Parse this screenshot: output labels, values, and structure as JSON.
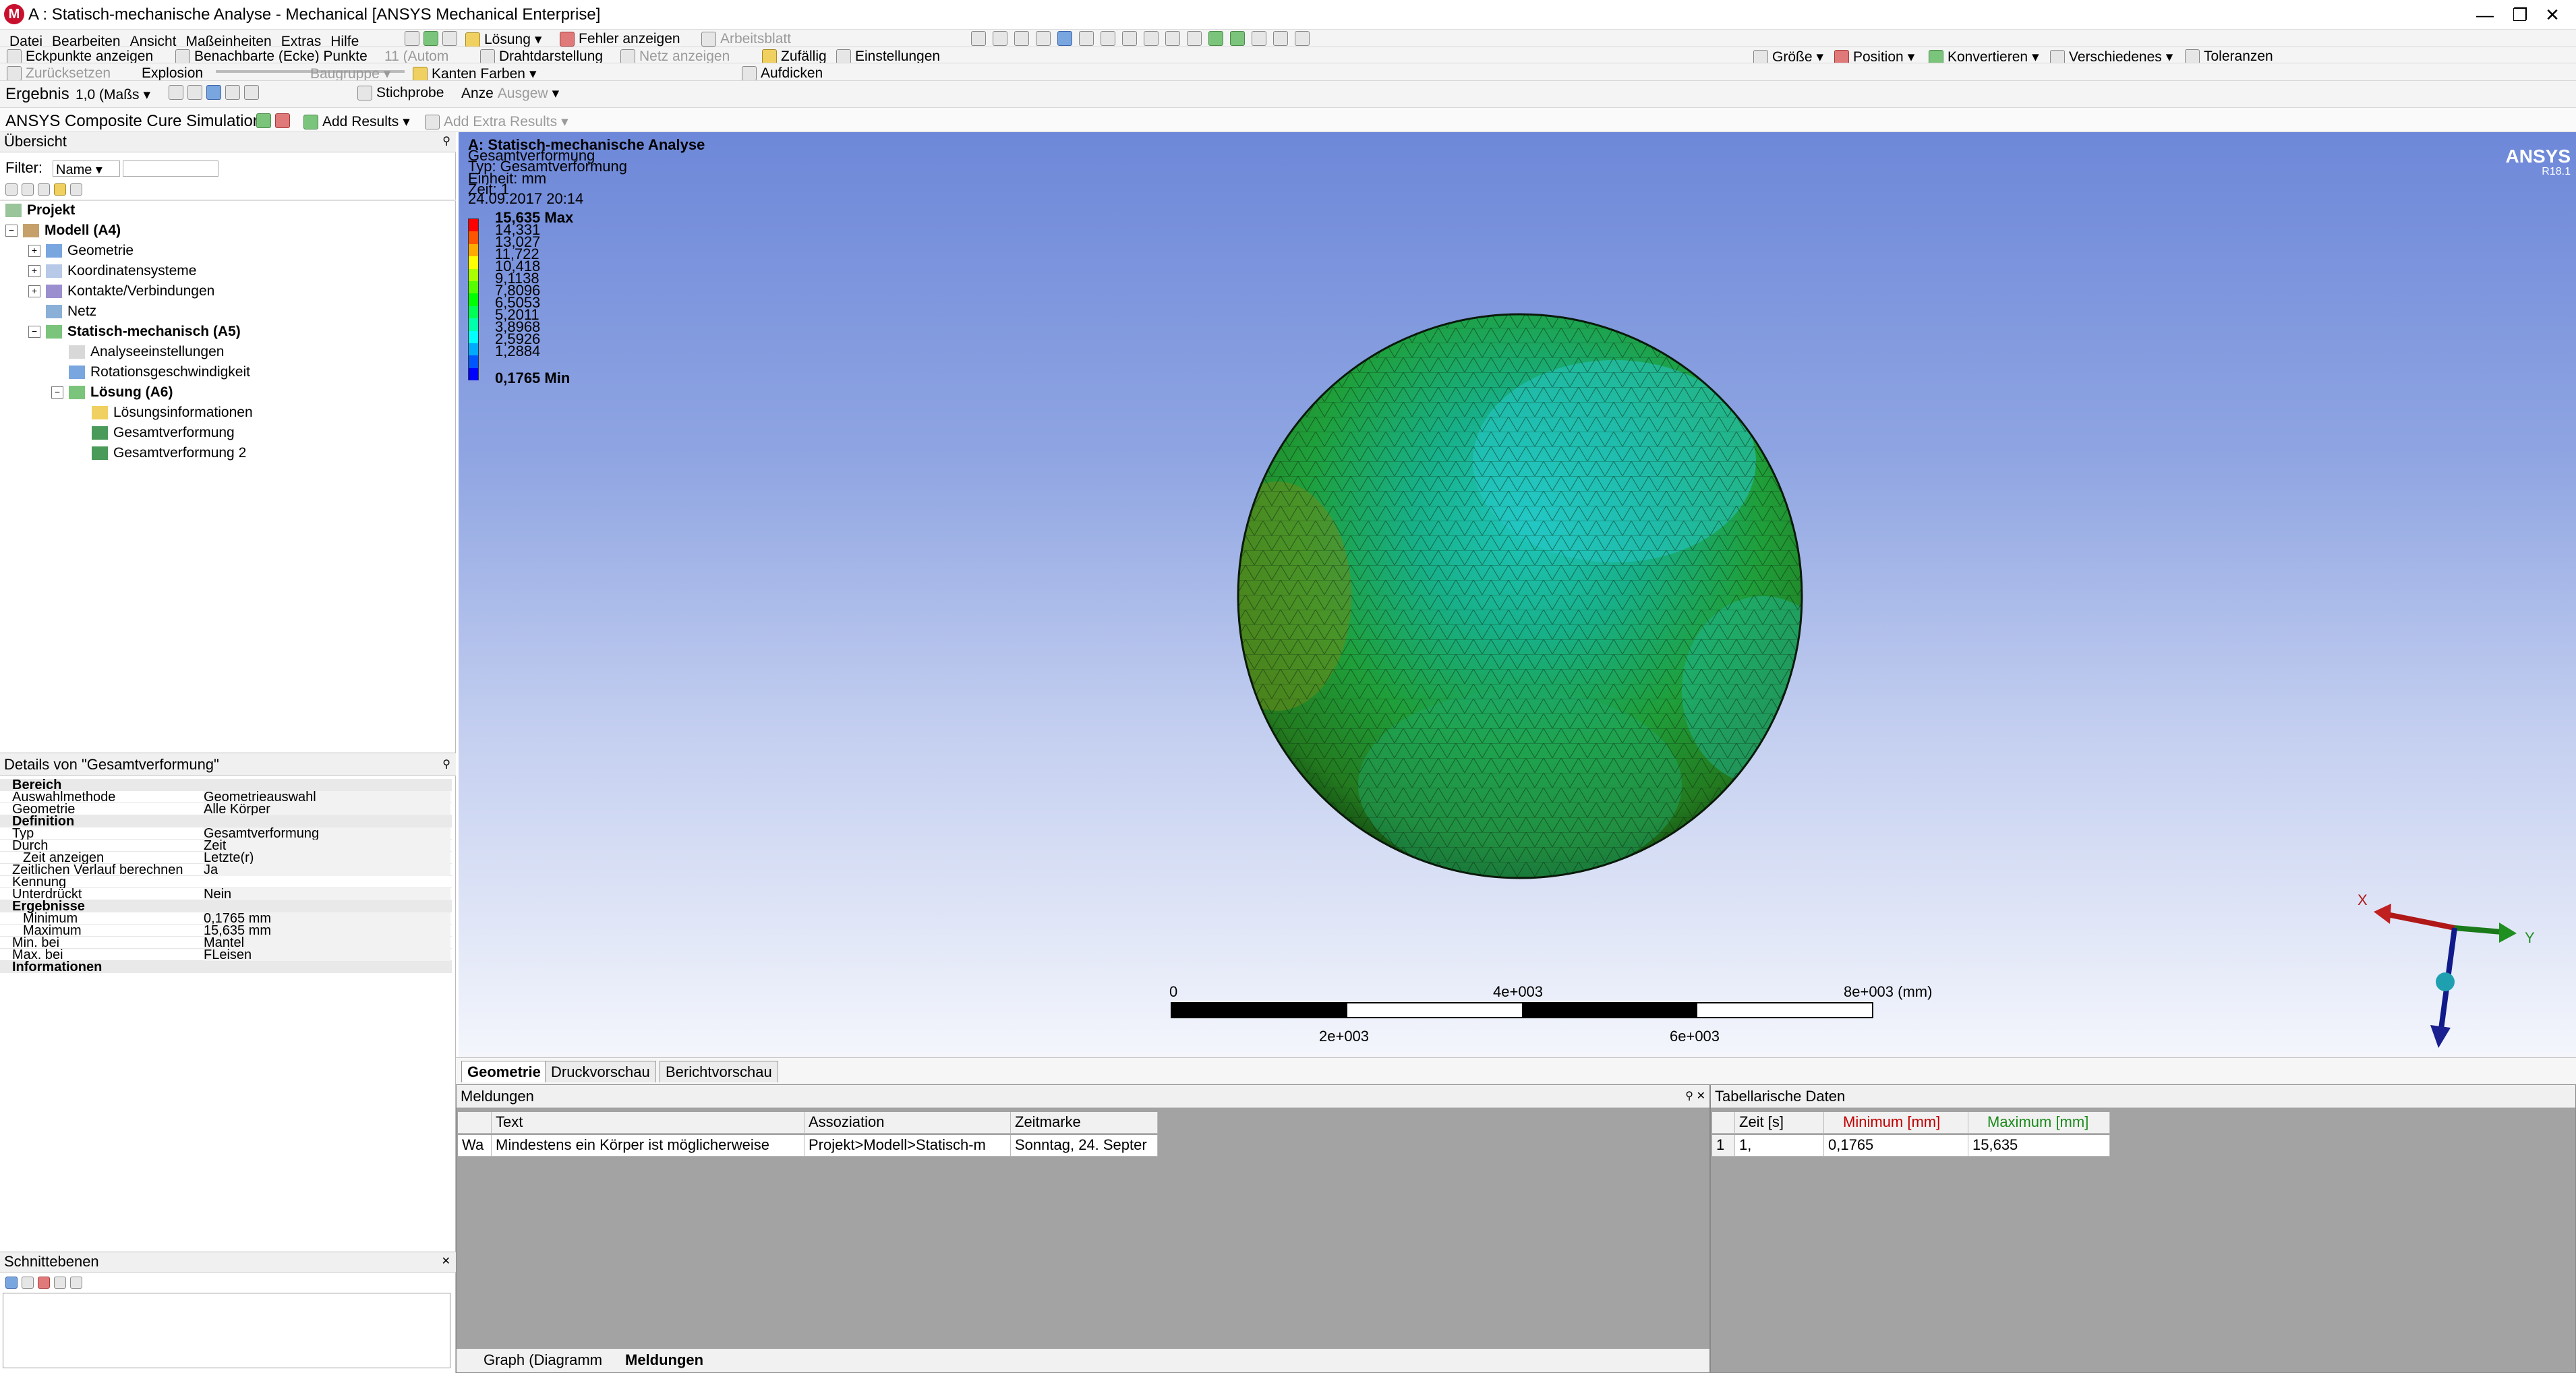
{
  "window": {
    "title": "A : Statisch-mechanische Analyse - Mechanical [ANSYS Mechanical Enterprise]",
    "minimize": "—",
    "restore": "❐",
    "close": "✕"
  },
  "menu": {
    "items": [
      "Datei",
      "Bearbeiten",
      "Ansicht",
      "Maßeinheiten",
      "Extras",
      "Hilfe"
    ],
    "losung": "Lösung",
    "fehler": "Fehler anzeigen",
    "arbeitsblatt": "Arbeitsblatt"
  },
  "toolbar2": {
    "eckpunkte": "Eckpunkte anzeigen",
    "benachbarte": "Benachbarte (Ecke) Punkte",
    "anzahl_value": "11 (Autom",
    "drahtdarstellung": "Drahtdarstellung",
    "netz": "Netz anzeigen",
    "zufaellig": "Zufällig",
    "einstellungen": "Einstellungen",
    "groesse": "Größe",
    "position": "Position",
    "konvertieren": "Konvertieren",
    "verschiedenes": "Verschiedenes",
    "toleranzen": "Toleranzen"
  },
  "toolbar3": {
    "zuruecksetzen": "Zurücksetzen",
    "explosion": "Explosion",
    "baugruppe": "Baugruppe",
    "kanten_farben": "Kanten Farben",
    "aufdicken": "Aufdicken"
  },
  "toolbar4": {
    "ergebnis": "Ergebnis",
    "scale_value": "1,0 (Maßs",
    "stichprobe": "Stichprobe",
    "anze": "Anze",
    "ausgew": "Ausgew"
  },
  "toolbar5": {
    "composite": "ANSYS Composite Cure Simulation",
    "add_results": "Add Results",
    "add_extra_results": "Add Extra Results"
  },
  "outline": {
    "header": "Übersicht",
    "filter_label": "Filter:",
    "filter_value": "Name",
    "tree": [
      {
        "label": "Projekt",
        "bold": true
      },
      {
        "label": "Modell (A4)",
        "bold": true
      },
      {
        "label": "Geometrie",
        "bold": false
      },
      {
        "label": "Koordinatensysteme",
        "bold": false
      },
      {
        "label": "Kontakte/Verbindungen",
        "bold": false
      },
      {
        "label": "Netz",
        "bold": false
      },
      {
        "label": "Statisch-mechanisch (A5)",
        "bold": true
      },
      {
        "label": "Analyseeinstellungen",
        "bold": false
      },
      {
        "label": "Rotationsgeschwindigkeit",
        "bold": false
      },
      {
        "label": "Lösung (A6)",
        "bold": true
      },
      {
        "label": "Lösungsinformationen",
        "bold": false
      },
      {
        "label": "Gesamtverformung",
        "bold": false
      },
      {
        "label": "Gesamtverformung 2",
        "bold": false
      }
    ]
  },
  "details": {
    "header": "Details von \"Gesamtverformung\"",
    "rows": [
      {
        "section": "Bereich"
      },
      {
        "key": "Auswahlmethode",
        "value": "Geometrieauswahl"
      },
      {
        "key": "Geometrie",
        "value": "Alle Körper"
      },
      {
        "section": "Definition"
      },
      {
        "key": "Typ",
        "value": "Gesamtverformung"
      },
      {
        "key": "Durch",
        "value": "Zeit"
      },
      {
        "key": "Zeit anzeigen",
        "value": "Letzte(r)"
      },
      {
        "key": "Zeitlichen Verlauf berechnen",
        "value": "Ja"
      },
      {
        "key": "Kennung",
        "value": ""
      },
      {
        "key": "Unterdrückt",
        "value": "Nein"
      },
      {
        "section": "Ergebnisse"
      },
      {
        "key": "Minimum",
        "value": "0,1765 mm"
      },
      {
        "key": "Maximum",
        "value": "15,635 mm"
      },
      {
        "key": "Min. bei",
        "value": "Mantel"
      },
      {
        "key": "Max. bei",
        "value": "FLeisen"
      },
      {
        "section": "Informationen"
      }
    ]
  },
  "schnitt": {
    "header": "Schnittebenen"
  },
  "viewport": {
    "analysis_title": "A: Statisch-mechanische Analyse",
    "result_name": "Gesamtverformung",
    "typ": "Typ: Gesamtverformung",
    "einheit": "Einheit: mm",
    "zeit": "Zeit: 1",
    "date": "24.09.2017 20:14",
    "brand": "ANSYS",
    "version": "R18.1",
    "legend_max": "15,635 Max",
    "legend_values": [
      "14,331",
      "13,027",
      "11,722",
      "10,418",
      "9,1138",
      "7,8096",
      "6,5053",
      "5,2011",
      "3,8968",
      "2,5926",
      "1,2884"
    ],
    "legend_min": "0,1765 Min",
    "legend_colors": [
      "#ff0000",
      "#ff5500",
      "#ffaa00",
      "#ffff00",
      "#aaff00",
      "#55ff00",
      "#00ff00",
      "#00ff55",
      "#00ffaa",
      "#00ffff",
      "#00aaff",
      "#0055ff",
      "#0000ff"
    ],
    "scale_top": [
      "0",
      "4e+003",
      "8e+003 (mm)"
    ],
    "scale_bottom": [
      "2e+003",
      "6e+003"
    ],
    "triad_x": "X",
    "triad_y": "Y"
  },
  "view_tabs": [
    "Geometrie",
    "Druckvorschau",
    "Berichtvorschau"
  ],
  "messages": {
    "header": "Meldungen",
    "columns": [
      "Text",
      "Assoziation",
      "Zeitmarke"
    ],
    "rows": [
      {
        "type": "Wa",
        "text": "Mindestens ein Körper ist möglicherweise",
        "assoc": "Projekt>Modell>Statisch-m",
        "time": "Sonntag, 24. Septer"
      }
    ]
  },
  "tabular": {
    "header": "Tabellarische Daten",
    "columns": [
      "Zeit [s]",
      "Minimum [mm]",
      "Maximum [mm]"
    ],
    "rows": [
      {
        "index": "1",
        "zeit": "1,",
        "min": "0,1765",
        "max": "15,635"
      }
    ]
  },
  "bottom_tabs": [
    "Graph (Diagramm",
    "Meldungen"
  ]
}
